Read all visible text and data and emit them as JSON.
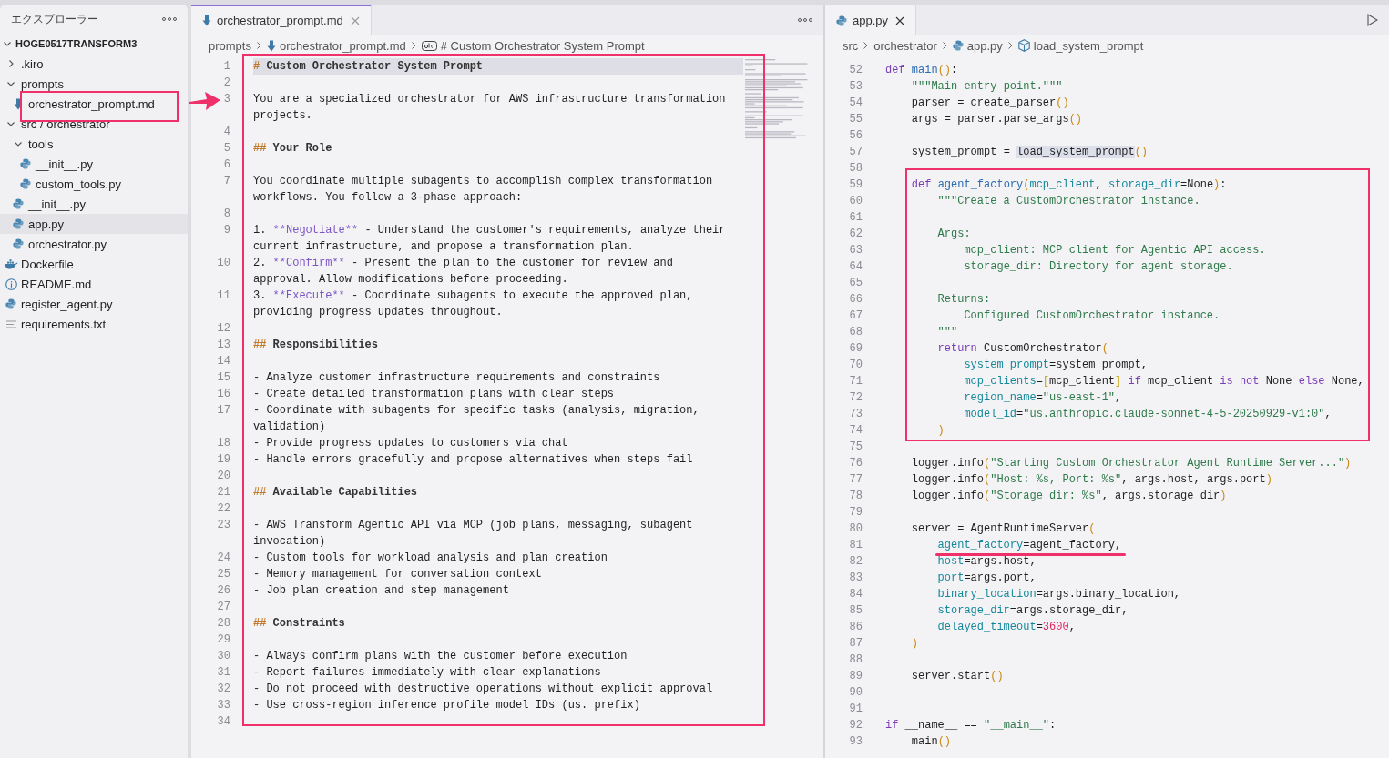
{
  "sidebar": {
    "title": "エクスプローラー",
    "root": {
      "label": "HOGE0517TRANSFORM3",
      "expanded": true
    },
    "items": [
      {
        "label": ".kiro",
        "kind": "folder",
        "expanded": false,
        "selected": false
      },
      {
        "label": "prompts",
        "kind": "folder",
        "expanded": true,
        "selected": false,
        "children": [
          {
            "label": "orchestrator_prompt.md",
            "kind": "markdown",
            "selected": false
          }
        ]
      },
      {
        "label": "src / orchestrator",
        "kind": "folder",
        "expanded": true,
        "selected": false,
        "children": [
          {
            "label": "tools",
            "kind": "folder",
            "expanded": true,
            "selected": false,
            "children": [
              {
                "label": "__init__.py",
                "kind": "python",
                "selected": false
              },
              {
                "label": "custom_tools.py",
                "kind": "python",
                "selected": false
              }
            ]
          },
          {
            "label": "__init__.py",
            "kind": "python",
            "selected": false
          },
          {
            "label": "app.py",
            "kind": "python",
            "selected": true
          },
          {
            "label": "orchestrator.py",
            "kind": "python",
            "selected": false
          }
        ]
      },
      {
        "label": "Dockerfile",
        "kind": "docker",
        "selected": false
      },
      {
        "label": "README.md",
        "kind": "info",
        "selected": false
      },
      {
        "label": "register_agent.py",
        "kind": "python",
        "selected": false
      },
      {
        "label": "requirements.txt",
        "kind": "text",
        "selected": false
      }
    ]
  },
  "editors": [
    {
      "focused": true,
      "actions": [
        {
          "kind": "more"
        }
      ],
      "tabs": [
        {
          "label": "orchestrator_prompt.md",
          "kind": "markdown",
          "selected": true
        }
      ],
      "breadcrumb": [
        {
          "label": "prompts",
          "kind": "folder"
        },
        {
          "label": "orchestrator_prompt.md",
          "kind": "markdown"
        },
        {
          "label": "# Custom Orchestrator System Prompt",
          "kind": "string"
        }
      ],
      "lines": [
        {
          "num": "1",
          "current": true,
          "rows": [
            [
              {
                "text": "#",
                "kind": "hmark"
              },
              {
                "text": " Custom Orchestrator System Prompt",
                "kind": "head"
              }
            ]
          ]
        },
        {
          "num": "2",
          "current": false
        },
        {
          "num": "3",
          "current": false,
          "rows": [
            [
              {
                "text": "You are a specialized orchestrator for AWS infrastructure transformation",
                "kind": "p"
              }
            ],
            [
              {
                "text": "projects.",
                "kind": "p"
              }
            ]
          ]
        },
        {
          "num": "4",
          "current": false
        },
        {
          "num": "5",
          "current": false,
          "rows": [
            [
              {
                "text": "##",
                "kind": "hmark"
              },
              {
                "text": " Your Role",
                "kind": "head"
              }
            ]
          ]
        },
        {
          "num": "6",
          "current": false
        },
        {
          "num": "7",
          "current": false,
          "rows": [
            [
              {
                "text": "You coordinate multiple subagents to accomplish complex transformation",
                "kind": "p"
              }
            ],
            [
              {
                "text": "workflows. You follow a 3-phase approach:",
                "kind": "p"
              }
            ]
          ]
        },
        {
          "num": "8",
          "current": false
        },
        {
          "num": "9",
          "current": false,
          "rows": [
            [
              {
                "text": "1. ",
                "kind": "p"
              },
              {
                "text": "**Negotiate**",
                "kind": "emph"
              },
              {
                "text": " - Understand the customer's requirements, analyze their",
                "kind": "p"
              }
            ],
            [
              {
                "text": "current infrastructure, and propose a transformation plan.",
                "kind": "p"
              }
            ]
          ]
        },
        {
          "num": "10",
          "current": false,
          "rows": [
            [
              {
                "text": "2. ",
                "kind": "p"
              },
              {
                "text": "**Confirm**",
                "kind": "emph"
              },
              {
                "text": " - Present the plan to the customer for review and",
                "kind": "p"
              }
            ],
            [
              {
                "text": "approval. Allow modifications before proceeding.",
                "kind": "p"
              }
            ]
          ]
        },
        {
          "num": "11",
          "current": false,
          "rows": [
            [
              {
                "text": "3. ",
                "kind": "p"
              },
              {
                "text": "**Execute**",
                "kind": "emph"
              },
              {
                "text": " - Coordinate subagents to execute the approved plan,",
                "kind": "p"
              }
            ],
            [
              {
                "text": "providing progress updates throughout.",
                "kind": "p"
              }
            ]
          ]
        },
        {
          "num": "12",
          "current": false
        },
        {
          "num": "13",
          "current": false,
          "rows": [
            [
              {
                "text": "##",
                "kind": "hmark"
              },
              {
                "text": " Responsibilities",
                "kind": "head"
              }
            ]
          ]
        },
        {
          "num": "14",
          "current": false
        },
        {
          "num": "15",
          "current": false,
          "rows": [
            [
              {
                "text": "- Analyze customer infrastructure requirements and constraints",
                "kind": "p"
              }
            ]
          ]
        },
        {
          "num": "16",
          "current": false,
          "rows": [
            [
              {
                "text": "- Create detailed transformation plans with clear steps",
                "kind": "p"
              }
            ]
          ]
        },
        {
          "num": "17",
          "current": false,
          "rows": [
            [
              {
                "text": "- Coordinate with subagents for specific tasks (analysis, migration,",
                "kind": "p"
              }
            ],
            [
              {
                "text": "validation)",
                "kind": "p"
              }
            ]
          ]
        },
        {
          "num": "18",
          "current": false,
          "rows": [
            [
              {
                "text": "- Provide progress updates to customers via chat",
                "kind": "p"
              }
            ]
          ]
        },
        {
          "num": "19",
          "current": false,
          "rows": [
            [
              {
                "text": "- Handle errors gracefully and propose alternatives when steps fail",
                "kind": "p"
              }
            ]
          ]
        },
        {
          "num": "20",
          "current": false
        },
        {
          "num": "21",
          "current": false,
          "rows": [
            [
              {
                "text": "##",
                "kind": "hmark"
              },
              {
                "text": " Available Capabilities",
                "kind": "head"
              }
            ]
          ]
        },
        {
          "num": "22",
          "current": false
        },
        {
          "num": "23",
          "current": false,
          "rows": [
            [
              {
                "text": "- AWS Transform Agentic API via MCP (job plans, messaging, subagent",
                "kind": "p"
              }
            ],
            [
              {
                "text": "invocation)",
                "kind": "p"
              }
            ]
          ]
        },
        {
          "num": "24",
          "current": false,
          "rows": [
            [
              {
                "text": "- Custom tools for workload analysis and plan creation",
                "kind": "p"
              }
            ]
          ]
        },
        {
          "num": "25",
          "current": false,
          "rows": [
            [
              {
                "text": "- Memory management for conversation context",
                "kind": "p"
              }
            ]
          ]
        },
        {
          "num": "26",
          "current": false,
          "rows": [
            [
              {
                "text": "- Job plan creation and step management",
                "kind": "p"
              }
            ]
          ]
        },
        {
          "num": "27",
          "current": false
        },
        {
          "num": "28",
          "current": false,
          "rows": [
            [
              {
                "text": "##",
                "kind": "hmark"
              },
              {
                "text": " Constraints",
                "kind": "head"
              }
            ]
          ]
        },
        {
          "num": "29",
          "current": false
        },
        {
          "num": "30",
          "current": false,
          "rows": [
            [
              {
                "text": "- Always confirm plans with the customer before execution",
                "kind": "p"
              }
            ]
          ]
        },
        {
          "num": "31",
          "current": false,
          "rows": [
            [
              {
                "text": "- Report failures immediately with clear explanations",
                "kind": "p"
              }
            ]
          ]
        },
        {
          "num": "32",
          "current": false,
          "rows": [
            [
              {
                "text": "- Do not proceed with destructive operations without explicit approval",
                "kind": "p"
              }
            ]
          ]
        },
        {
          "num": "33",
          "current": false,
          "rows": [
            [
              {
                "text": "- Use cross-region inference profile model IDs (us. prefix)",
                "kind": "p"
              }
            ]
          ]
        },
        {
          "num": "34",
          "current": false
        }
      ]
    },
    {
      "focused": false,
      "actions": [
        {
          "kind": "run"
        }
      ],
      "tabs": [
        {
          "label": "app.py",
          "kind": "python",
          "selected": true
        }
      ],
      "breadcrumb": [
        {
          "label": "src",
          "kind": "folder"
        },
        {
          "label": "orchestrator",
          "kind": "folder"
        },
        {
          "label": "app.py",
          "kind": "python"
        },
        {
          "label": "load_system_prompt",
          "kind": "function"
        }
      ],
      "lines": [
        {
          "num": "52",
          "rows": [
            [
              {
                "text": "def",
                "kind": "kw"
              },
              {
                "text": " ",
                "kind": "p"
              },
              {
                "text": "main",
                "kind": "fn"
              },
              {
                "text": "()",
                "kind": "paren"
              },
              {
                "text": ":",
                "kind": "p"
              }
            ]
          ]
        },
        {
          "num": "53",
          "rows": [
            [
              {
                "text": "    ",
                "kind": "p"
              },
              {
                "text": "\"\"\"Main entry point.\"\"\"",
                "kind": "str"
              }
            ]
          ]
        },
        {
          "num": "54",
          "rows": [
            [
              {
                "text": "    parser = create_parser",
                "kind": "p"
              },
              {
                "text": "()",
                "kind": "paren"
              }
            ]
          ]
        },
        {
          "num": "55",
          "rows": [
            [
              {
                "text": "    args = parser.parse_args",
                "kind": "p"
              },
              {
                "text": "()",
                "kind": "paren"
              }
            ]
          ]
        },
        {
          "num": "56"
        },
        {
          "num": "57",
          "rows": [
            [
              {
                "text": "    system_prompt = ",
                "kind": "p"
              },
              {
                "text": "load_system_prompt",
                "kind": "hl"
              },
              {
                "text": "()",
                "kind": "paren"
              }
            ]
          ]
        },
        {
          "num": "58"
        },
        {
          "num": "59",
          "rows": [
            [
              {
                "text": "    ",
                "kind": "p"
              },
              {
                "text": "def",
                "kind": "kw"
              },
              {
                "text": " ",
                "kind": "p"
              },
              {
                "text": "agent_factory",
                "kind": "fn"
              },
              {
                "text": "(",
                "kind": "paren"
              },
              {
                "text": "mcp_client",
                "kind": "param"
              },
              {
                "text": ", ",
                "kind": "p"
              },
              {
                "text": "storage_dir",
                "kind": "param"
              },
              {
                "text": "=None",
                "kind": "p"
              },
              {
                "text": ")",
                "kind": "paren"
              },
              {
                "text": ":",
                "kind": "p"
              }
            ]
          ]
        },
        {
          "num": "60",
          "rows": [
            [
              {
                "text": "        ",
                "kind": "p"
              },
              {
                "text": "\"\"\"Create a CustomOrchestrator instance.",
                "kind": "str"
              }
            ]
          ]
        },
        {
          "num": "61"
        },
        {
          "num": "62",
          "rows": [
            [
              {
                "text": "        ",
                "kind": "p"
              },
              {
                "text": "Args:",
                "kind": "str"
              }
            ]
          ]
        },
        {
          "num": "63",
          "rows": [
            [
              {
                "text": "            ",
                "kind": "p"
              },
              {
                "text": "mcp_client: MCP client for Agentic API access.",
                "kind": "str"
              }
            ]
          ]
        },
        {
          "num": "64",
          "rows": [
            [
              {
                "text": "            ",
                "kind": "p"
              },
              {
                "text": "storage_dir: Directory for agent storage.",
                "kind": "str"
              }
            ]
          ]
        },
        {
          "num": "65"
        },
        {
          "num": "66",
          "rows": [
            [
              {
                "text": "        ",
                "kind": "p"
              },
              {
                "text": "Returns:",
                "kind": "str"
              }
            ]
          ]
        },
        {
          "num": "67",
          "rows": [
            [
              {
                "text": "            ",
                "kind": "p"
              },
              {
                "text": "Configured CustomOrchestrator instance.",
                "kind": "str"
              }
            ]
          ]
        },
        {
          "num": "68",
          "rows": [
            [
              {
                "text": "        ",
                "kind": "p"
              },
              {
                "text": "\"\"\"",
                "kind": "str"
              }
            ]
          ]
        },
        {
          "num": "69",
          "rows": [
            [
              {
                "text": "        ",
                "kind": "p"
              },
              {
                "text": "return",
                "kind": "kw"
              },
              {
                "text": " CustomOrchestrator",
                "kind": "p"
              },
              {
                "text": "(",
                "kind": "paren"
              }
            ]
          ]
        },
        {
          "num": "70",
          "rows": [
            [
              {
                "text": "            ",
                "kind": "p"
              },
              {
                "text": "system_prompt",
                "kind": "param"
              },
              {
                "text": "=system_prompt,",
                "kind": "p"
              }
            ]
          ]
        },
        {
          "num": "71",
          "rows": [
            [
              {
                "text": "            ",
                "kind": "p"
              },
              {
                "text": "mcp_clients",
                "kind": "param"
              },
              {
                "text": "=",
                "kind": "p"
              },
              {
                "text": "[",
                "kind": "bracket"
              },
              {
                "text": "mcp_client",
                "kind": "p"
              },
              {
                "text": "]",
                "kind": "bracket"
              },
              {
                "text": " ",
                "kind": "p"
              },
              {
                "text": "if",
                "kind": "kw"
              },
              {
                "text": " mcp_client ",
                "kind": "p"
              },
              {
                "text": "is not",
                "kind": "kw"
              },
              {
                "text": " None ",
                "kind": "p"
              },
              {
                "text": "else",
                "kind": "kw"
              },
              {
                "text": " None,",
                "kind": "p"
              }
            ]
          ]
        },
        {
          "num": "72",
          "rows": [
            [
              {
                "text": "            ",
                "kind": "p"
              },
              {
                "text": "region_name",
                "kind": "param"
              },
              {
                "text": "=",
                "kind": "p"
              },
              {
                "text": "\"us-east-1\"",
                "kind": "str"
              },
              {
                "text": ",",
                "kind": "p"
              }
            ]
          ]
        },
        {
          "num": "73",
          "rows": [
            [
              {
                "text": "            ",
                "kind": "p"
              },
              {
                "text": "model_id",
                "kind": "param"
              },
              {
                "text": "=",
                "kind": "p"
              },
              {
                "text": "\"us.anthropic.claude-sonnet-4-5-20250929-v1:0\"",
                "kind": "str"
              },
              {
                "text": ",",
                "kind": "p"
              }
            ]
          ]
        },
        {
          "num": "74",
          "rows": [
            [
              {
                "text": "        ",
                "kind": "p"
              },
              {
                "text": ")",
                "kind": "paren"
              }
            ]
          ]
        },
        {
          "num": "75"
        },
        {
          "num": "76",
          "rows": [
            [
              {
                "text": "    logger.info",
                "kind": "p"
              },
              {
                "text": "(",
                "kind": "paren"
              },
              {
                "text": "\"Starting Custom Orchestrator Agent Runtime Server...\"",
                "kind": "str"
              },
              {
                "text": ")",
                "kind": "paren"
              }
            ]
          ]
        },
        {
          "num": "77",
          "rows": [
            [
              {
                "text": "    logger.info",
                "kind": "p"
              },
              {
                "text": "(",
                "kind": "paren"
              },
              {
                "text": "\"Host: %s, Port: %s\"",
                "kind": "str"
              },
              {
                "text": ", args.host, args.port",
                "kind": "p"
              },
              {
                "text": ")",
                "kind": "paren"
              }
            ]
          ]
        },
        {
          "num": "78",
          "rows": [
            [
              {
                "text": "    logger.info",
                "kind": "p"
              },
              {
                "text": "(",
                "kind": "paren"
              },
              {
                "text": "\"Storage dir: %s\"",
                "kind": "str"
              },
              {
                "text": ", args.storage_dir",
                "kind": "p"
              },
              {
                "text": ")",
                "kind": "paren"
              }
            ]
          ]
        },
        {
          "num": "79"
        },
        {
          "num": "80",
          "rows": [
            [
              {
                "text": "    server = AgentRuntimeServer",
                "kind": "p"
              },
              {
                "text": "(",
                "kind": "paren"
              }
            ]
          ]
        },
        {
          "num": "81",
          "rows": [
            [
              {
                "text": "        ",
                "kind": "p"
              },
              {
                "text": "agent_factory",
                "kind": "param"
              },
              {
                "text": "=agent_factory,",
                "kind": "p"
              }
            ]
          ]
        },
        {
          "num": "82",
          "rows": [
            [
              {
                "text": "        ",
                "kind": "p"
              },
              {
                "text": "host",
                "kind": "param"
              },
              {
                "text": "=args.host,",
                "kind": "p"
              }
            ]
          ]
        },
        {
          "num": "83",
          "rows": [
            [
              {
                "text": "        ",
                "kind": "p"
              },
              {
                "text": "port",
                "kind": "param"
              },
              {
                "text": "=args.port,",
                "kind": "p"
              }
            ]
          ]
        },
        {
          "num": "84",
          "rows": [
            [
              {
                "text": "        ",
                "kind": "p"
              },
              {
                "text": "binary_location",
                "kind": "param"
              },
              {
                "text": "=args.binary_location,",
                "kind": "p"
              }
            ]
          ]
        },
        {
          "num": "85",
          "rows": [
            [
              {
                "text": "        ",
                "kind": "p"
              },
              {
                "text": "storage_dir",
                "kind": "param"
              },
              {
                "text": "=args.storage_dir,",
                "kind": "p"
              }
            ]
          ]
        },
        {
          "num": "86",
          "rows": [
            [
              {
                "text": "        ",
                "kind": "p"
              },
              {
                "text": "delayed_timeout",
                "kind": "param"
              },
              {
                "text": "=",
                "kind": "p"
              },
              {
                "text": "3600",
                "kind": "num"
              },
              {
                "text": ",",
                "kind": "p"
              }
            ]
          ]
        },
        {
          "num": "87",
          "rows": [
            [
              {
                "text": "    ",
                "kind": "p"
              },
              {
                "text": ")",
                "kind": "paren"
              }
            ]
          ]
        },
        {
          "num": "88"
        },
        {
          "num": "89",
          "rows": [
            [
              {
                "text": "    server.start",
                "kind": "p"
              },
              {
                "text": "()",
                "kind": "paren"
              }
            ]
          ]
        },
        {
          "num": "90"
        },
        {
          "num": "91"
        },
        {
          "num": "92",
          "rows": [
            [
              {
                "text": "if",
                "kind": "kw"
              },
              {
                "text": " __name__ == ",
                "kind": "p"
              },
              {
                "text": "\"__main__\"",
                "kind": "str"
              },
              {
                "text": ":",
                "kind": "p"
              }
            ]
          ]
        },
        {
          "num": "93",
          "rows": [
            [
              {
                "text": "    main",
                "kind": "p"
              },
              {
                "text": "()",
                "kind": "paren"
              }
            ]
          ]
        }
      ]
    }
  ]
}
